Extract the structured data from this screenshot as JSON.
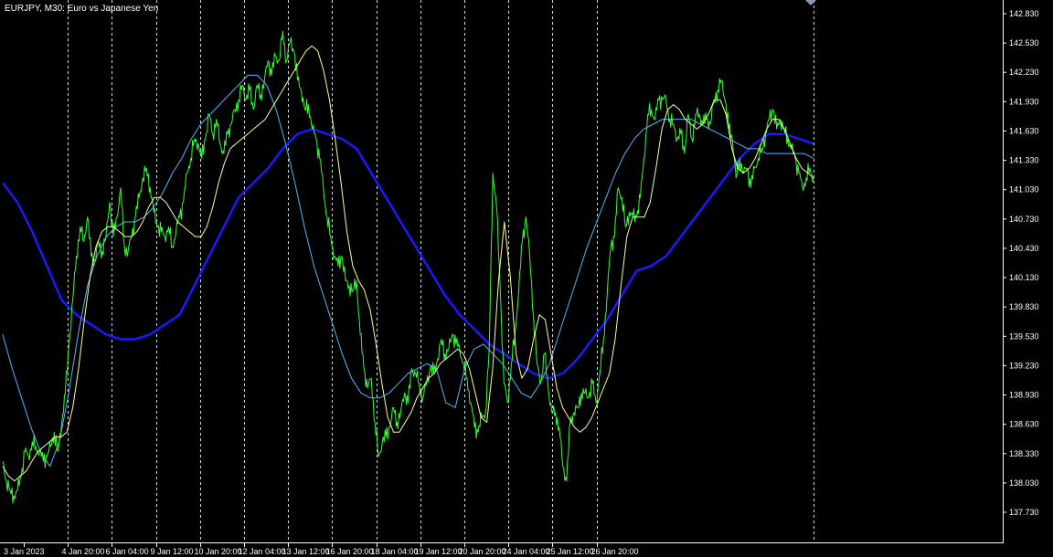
{
  "header": {
    "symbol_line": "EURJPY, M30:  Euro vs Japanese Yen"
  },
  "colors": {
    "background": "#000000",
    "axis": "#ffffff",
    "grid": "#ffffff",
    "price": "#33ff33",
    "ma_fast": "#ffff99",
    "ma_medium": "#4fb7ff",
    "ma_slow": "#1a1aff"
  },
  "chart_data": {
    "type": "line",
    "symbol": "EURJPY",
    "timeframe": "M30",
    "description": "Euro vs Japanese Yen",
    "ylim": [
      137.6,
      142.95
    ],
    "y_ticks": [
      "142.830",
      "142.530",
      "142.230",
      "141.930",
      "141.630",
      "141.330",
      "141.030",
      "140.730",
      "140.430",
      "140.130",
      "139.830",
      "139.530",
      "139.230",
      "138.930",
      "138.630",
      "138.330",
      "138.030",
      "137.730"
    ],
    "x_ticks": [
      "3 Jan 2023",
      "4 Jan 20:00",
      "6 Jan 04:00",
      "9 Jan 12:00",
      "10 Jan 20:00",
      "12 Jan 04:00",
      "13 Jan 12:00",
      "16 Jan 20:00",
      "18 Jan 04:00",
      "19 Jan 12:00",
      "20 Jan 20:00",
      "24 Jan 04:00",
      "25 Jan 12:00",
      "26 Jan 20:00"
    ],
    "x": [
      0,
      2,
      4,
      6,
      8,
      10,
      12,
      14,
      16,
      18,
      20,
      22,
      24,
      26,
      28,
      30,
      32,
      34,
      36,
      38,
      40,
      42,
      44,
      46,
      48,
      50,
      52,
      54,
      56,
      58,
      60,
      62,
      64,
      66,
      68,
      70,
      72,
      74,
      76,
      78,
      80,
      82,
      84,
      86,
      88,
      90,
      92,
      94,
      96,
      98,
      100,
      102,
      104,
      106,
      108,
      110,
      112,
      114,
      116,
      118,
      120,
      122,
      124,
      126,
      128,
      130,
      132,
      134,
      136,
      138,
      140,
      142,
      144,
      146,
      148,
      150,
      152,
      154,
      156,
      158,
      160,
      162,
      164,
      166,
      168,
      170,
      172,
      174,
      176,
      178,
      180,
      182,
      184,
      186,
      188,
      190,
      192,
      194,
      196,
      198,
      200,
      202,
      204,
      206,
      208,
      210,
      212,
      214,
      216,
      218,
      220,
      222,
      224,
      226,
      228,
      230,
      232,
      234,
      236,
      238,
      240,
      242,
      244,
      246,
      248,
      250,
      252,
      254,
      256,
      258,
      260,
      262,
      264,
      266,
      268,
      270,
      272,
      274,
      276,
      278,
      280,
      282,
      284,
      286,
      288,
      290,
      292,
      294,
      296,
      298,
      300,
      302,
      304,
      306,
      308,
      310,
      312,
      314,
      316,
      318,
      320,
      322,
      324,
      326,
      328,
      330,
      332,
      334,
      336,
      338,
      340,
      342,
      344,
      346,
      348,
      350,
      352,
      354,
      356,
      358,
      360,
      362,
      364,
      366,
      368,
      370,
      372,
      374,
      376,
      378,
      380,
      382,
      384,
      386,
      388,
      390,
      392,
      394,
      396,
      398,
      400,
      402,
      404,
      406,
      408,
      410,
      412,
      414,
      416,
      418,
      420,
      422,
      424,
      426,
      428,
      430,
      432,
      434,
      436,
      438,
      440,
      442,
      444,
      446,
      448,
      450,
      452,
      454,
      456,
      458,
      460,
      462,
      464,
      466,
      468,
      470,
      472,
      474,
      476,
      478,
      480,
      482,
      484,
      486,
      488,
      490,
      492,
      494,
      496,
      498,
      500,
      502,
      504,
      506,
      508,
      510,
      512,
      514,
      516,
      518,
      520,
      522,
      524,
      526,
      528,
      530,
      532,
      534,
      536,
      538,
      540,
      542,
      544,
      546,
      548,
      550,
      552,
      554,
      556,
      558,
      560,
      562,
      564,
      566,
      568,
      570,
      572,
      574,
      576,
      578,
      580,
      582,
      584,
      586,
      588,
      590,
      592,
      594,
      596,
      598,
      600,
      602,
      604,
      606,
      608,
      610,
      612,
      614,
      616,
      618,
      620,
      622,
      624,
      626,
      628,
      630,
      632,
      634,
      636,
      638,
      640,
      642,
      644,
      646,
      648,
      650,
      652,
      654,
      656,
      658,
      660,
      662,
      664,
      666,
      668,
      670
    ],
    "series": [
      {
        "values": [
          138.25,
          138.05,
          137.95,
          137.9,
          137.95,
          138.1,
          138.35,
          138.3,
          138.45,
          138.4,
          138.35,
          138.25,
          138.3,
          138.4,
          138.55,
          138.35,
          138.65,
          138.95,
          139.45,
          139.9,
          140.35,
          140.65,
          140.5,
          140.75,
          140.35,
          140.3,
          140.5,
          140.4,
          140.55,
          140.9,
          140.55,
          140.75,
          141.05,
          140.45,
          140.4,
          140.55,
          140.75,
          140.95,
          141.15,
          141.25,
          141.05,
          140.8,
          140.65,
          140.6,
          140.55,
          140.65,
          140.45,
          140.6,
          140.75,
          140.9,
          141.2,
          141.35,
          141.55,
          141.5,
          141.35,
          141.55,
          141.8,
          141.6,
          141.75,
          141.5,
          141.4,
          141.6,
          141.7,
          141.85,
          141.95,
          142.1,
          141.95,
          142.05,
          141.85,
          142.1,
          142.0,
          142.15,
          142.35,
          142.2,
          142.4,
          142.35,
          142.65,
          142.35,
          142.55,
          142.45,
          142.15,
          142.05,
          141.85,
          141.9,
          141.65,
          141.55,
          141.35,
          141.05,
          140.75,
          140.55,
          140.35,
          140.25,
          140.35,
          140.1,
          140.05,
          140.0,
          140.1,
          139.55,
          139.2,
          139.0,
          139.1,
          138.65,
          138.3,
          138.45,
          138.5,
          138.6,
          138.8,
          138.65,
          138.75,
          138.95,
          138.85,
          139.2,
          139.15,
          139.05,
          138.9,
          139.05,
          139.2,
          139.15,
          139.3,
          139.5,
          139.35,
          139.4,
          139.55,
          139.45,
          139.4,
          139.25,
          139.1,
          138.85,
          138.6,
          138.55,
          138.7,
          138.75,
          139.4,
          141.2,
          140.85,
          140.0,
          139.05,
          138.85,
          139.25,
          139.55,
          140.0,
          140.5,
          140.75,
          140.35,
          139.75,
          139.25,
          139.05,
          139.35,
          139.0,
          138.75,
          138.75,
          138.6,
          138.2,
          138.05,
          138.65,
          138.75,
          138.8,
          138.95,
          138.95,
          138.9,
          139.05,
          138.85,
          139.15,
          139.5,
          139.95,
          140.45,
          140.55,
          141.05,
          140.95,
          140.65,
          140.8,
          140.75,
          140.75,
          140.95,
          141.35,
          141.8,
          141.85,
          141.75,
          141.95,
          141.95,
          141.95,
          141.75,
          141.7,
          141.55,
          141.6,
          141.4,
          141.8,
          141.55,
          141.8,
          141.8,
          141.7,
          141.75,
          141.7,
          141.95,
          142.05,
          142.15,
          141.95,
          141.65,
          141.55,
          141.15,
          141.35,
          141.2,
          141.25,
          141.05,
          141.25,
          141.35,
          141.45,
          141.6,
          141.75,
          141.85,
          141.65,
          141.75,
          141.65,
          141.55,
          141.45,
          141.35,
          141.2,
          141.05,
          141.15,
          141.25,
          141.15
        ],
        "note_x_start": 0,
        "note_x_step": 3
      }
    ],
    "ma_fast_values": [
      138.2,
      138.1,
      138.05,
      138.1,
      138.15,
      138.25,
      138.35,
      138.4,
      138.45,
      138.5,
      138.5,
      138.55,
      138.8,
      139.2,
      139.7,
      140.15,
      140.45,
      140.6,
      140.65,
      140.65,
      140.6,
      140.55,
      140.55,
      140.6,
      140.7,
      140.85,
      140.95,
      140.95,
      140.9,
      140.8,
      140.7,
      140.65,
      140.6,
      140.55,
      140.55,
      140.65,
      140.85,
      141.1,
      141.3,
      141.45,
      141.5,
      141.55,
      141.6,
      141.65,
      141.7,
      141.75,
      141.85,
      141.95,
      142.05,
      142.15,
      142.25,
      142.35,
      142.45,
      142.5,
      142.45,
      142.25,
      141.95,
      141.55,
      141.1,
      140.6,
      140.25,
      140.1,
      140.0,
      139.8,
      139.45,
      139.05,
      138.7,
      138.55,
      138.55,
      138.65,
      138.75,
      138.9,
      139.0,
      139.1,
      139.15,
      139.25,
      139.3,
      139.35,
      139.4,
      139.35,
      139.2,
      138.95,
      138.7,
      138.65,
      139.2,
      140.1,
      140.7,
      140.15,
      139.35,
      139.1,
      139.2,
      139.5,
      139.75,
      139.7,
      139.35,
      139.0,
      138.8,
      138.7,
      138.6,
      138.55,
      138.6,
      138.7,
      138.85,
      139.0,
      139.15,
      139.5,
      140.05,
      140.55,
      140.75,
      140.75,
      140.75,
      140.9,
      141.25,
      141.65,
      141.85,
      141.9,
      141.85,
      141.75,
      141.7,
      141.65,
      141.7,
      141.8,
      141.95,
      141.95,
      141.8,
      141.45,
      141.25,
      141.2,
      141.25,
      141.35,
      141.5,
      141.65,
      141.75,
      141.75,
      141.65,
      141.5,
      141.35,
      141.25,
      141.2,
      141.15
    ],
    "ma_medium_values": [
      139.55,
      139.2,
      138.9,
      138.6,
      138.35,
      138.2,
      138.45,
      138.95,
      139.55,
      140.05,
      140.35,
      140.55,
      140.65,
      140.7,
      140.7,
      140.75,
      140.85,
      141.0,
      141.2,
      141.35,
      141.55,
      141.7,
      141.8,
      141.9,
      142.0,
      142.1,
      142.2,
      142.2,
      142.1,
      141.85,
      141.5,
      141.1,
      140.65,
      140.25,
      139.95,
      139.65,
      139.35,
      139.1,
      138.95,
      138.9,
      138.9,
      138.95,
      139.05,
      139.15,
      139.2,
      139.25,
      139.2,
      138.85,
      138.8,
      139.2,
      139.4,
      139.45,
      139.35,
      139.25,
      139.1,
      138.95,
      138.9,
      139.05,
      139.25,
      139.55,
      139.85,
      140.15,
      140.45,
      140.7,
      140.95,
      141.2,
      141.4,
      141.55,
      141.65,
      141.7,
      141.75,
      141.75,
      141.75,
      141.75,
      141.7,
      141.65,
      141.6,
      141.55,
      141.5,
      141.45,
      141.45,
      141.4,
      141.4,
      141.4,
      141.4,
      141.4,
      141.35
    ],
    "ma_slow_values": [
      141.1,
      140.9,
      140.6,
      140.25,
      139.9,
      139.75,
      139.65,
      139.55,
      139.5,
      139.5,
      139.55,
      139.65,
      139.75,
      140.05,
      140.35,
      140.65,
      140.95,
      141.1,
      141.25,
      141.45,
      141.6,
      141.65,
      141.6,
      141.55,
      141.45,
      141.2,
      140.95,
      140.7,
      140.45,
      140.2,
      139.95,
      139.75,
      139.6,
      139.45,
      139.35,
      139.25,
      139.15,
      139.1,
      139.15,
      139.3,
      139.5,
      139.7,
      139.95,
      140.2,
      140.25,
      140.35,
      140.55,
      140.75,
      140.95,
      141.15,
      141.35,
      141.5,
      141.6,
      141.6,
      141.55,
      141.5
    ]
  }
}
